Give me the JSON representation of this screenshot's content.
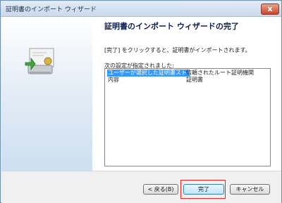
{
  "window": {
    "title": "証明書のインポート ウィザード",
    "close_symbol": "x"
  },
  "page": {
    "heading": "証明書のインポート ウィザードの完了",
    "description": "[完了] をクリックすると、証明書がインポートされます。",
    "settings_label": "次の設定が指定されました:"
  },
  "settings": [
    {
      "key": "ユーザーが選択した証明書ストア",
      "value": "信頼されたルート証明機関",
      "selected": true
    },
    {
      "key": "内容",
      "value": "証明書",
      "selected": false
    }
  ],
  "buttons": {
    "back": "< 戻る(B)",
    "finish": "完了",
    "cancel": "キャンセル"
  },
  "colors": {
    "selection": "#3399ff",
    "heading": "#0a1d52",
    "highlight": "#e22222"
  }
}
